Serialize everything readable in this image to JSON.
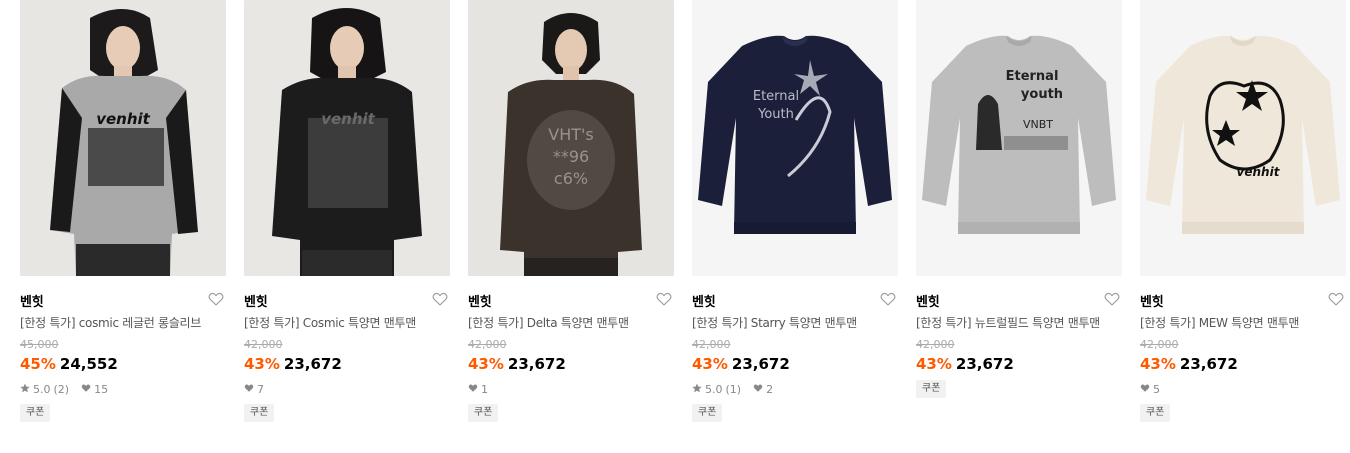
{
  "colors": {
    "discount": "#ff5a00",
    "meta": "#888888",
    "coupon_bg": "#f1f1f1"
  },
  "products": [
    {
      "brand": "벤힛",
      "name": "[한정 특가] cosmic 레글런 롱슬리브",
      "original_price": "45,000",
      "discount": "45%",
      "price": "24,552",
      "rating": "5.0",
      "review_count": "(2)",
      "likes": "15",
      "coupon": "쿠폰",
      "like_icon": "heart-outline-icon",
      "print_text": "venhit"
    },
    {
      "brand": "벤힛",
      "name": "[한정 특가] Cosmic 특양면 맨투맨",
      "original_price": "42,000",
      "discount": "43%",
      "price": "23,672",
      "likes": "7",
      "coupon": "쿠폰",
      "like_icon": "heart-outline-icon",
      "print_text": "venhit"
    },
    {
      "brand": "벤힛",
      "name": "[한정 특가] Delta 특양면 맨투맨",
      "original_price": "42,000",
      "discount": "43%",
      "price": "23,672",
      "likes": "1",
      "coupon": "쿠폰",
      "like_icon": "heart-outline-icon",
      "print_text_1": "VHT's",
      "print_text_2": "**96",
      "print_text_3": "c6%"
    },
    {
      "brand": "벤힛",
      "name": "[한정 특가] Starry 특양면 맨투맨",
      "original_price": "42,000",
      "discount": "43%",
      "price": "23,672",
      "rating": "5.0",
      "review_count": "(1)",
      "likes": "2",
      "coupon": "쿠폰",
      "like_icon": "heart-outline-icon",
      "print_text_1": "Eternal",
      "print_text_2": "Youth"
    },
    {
      "brand": "벤힛",
      "name": "[한정 특가] 뉴트럴필드 특양면 맨투맨",
      "original_price": "42,000",
      "discount": "43%",
      "price": "23,672",
      "coupon": "쿠폰",
      "like_icon": "heart-outline-icon",
      "print_text_1": "Eternal",
      "print_text_2": "youth",
      "print_text_3": "VNBT"
    },
    {
      "brand": "벤힛",
      "name": "[한정 특가] MEW 특양면 맨투맨",
      "original_price": "42,000",
      "discount": "43%",
      "price": "23,672",
      "likes": "5",
      "coupon": "쿠폰",
      "like_icon": "heart-outline-icon",
      "print_text": "venhit"
    }
  ]
}
